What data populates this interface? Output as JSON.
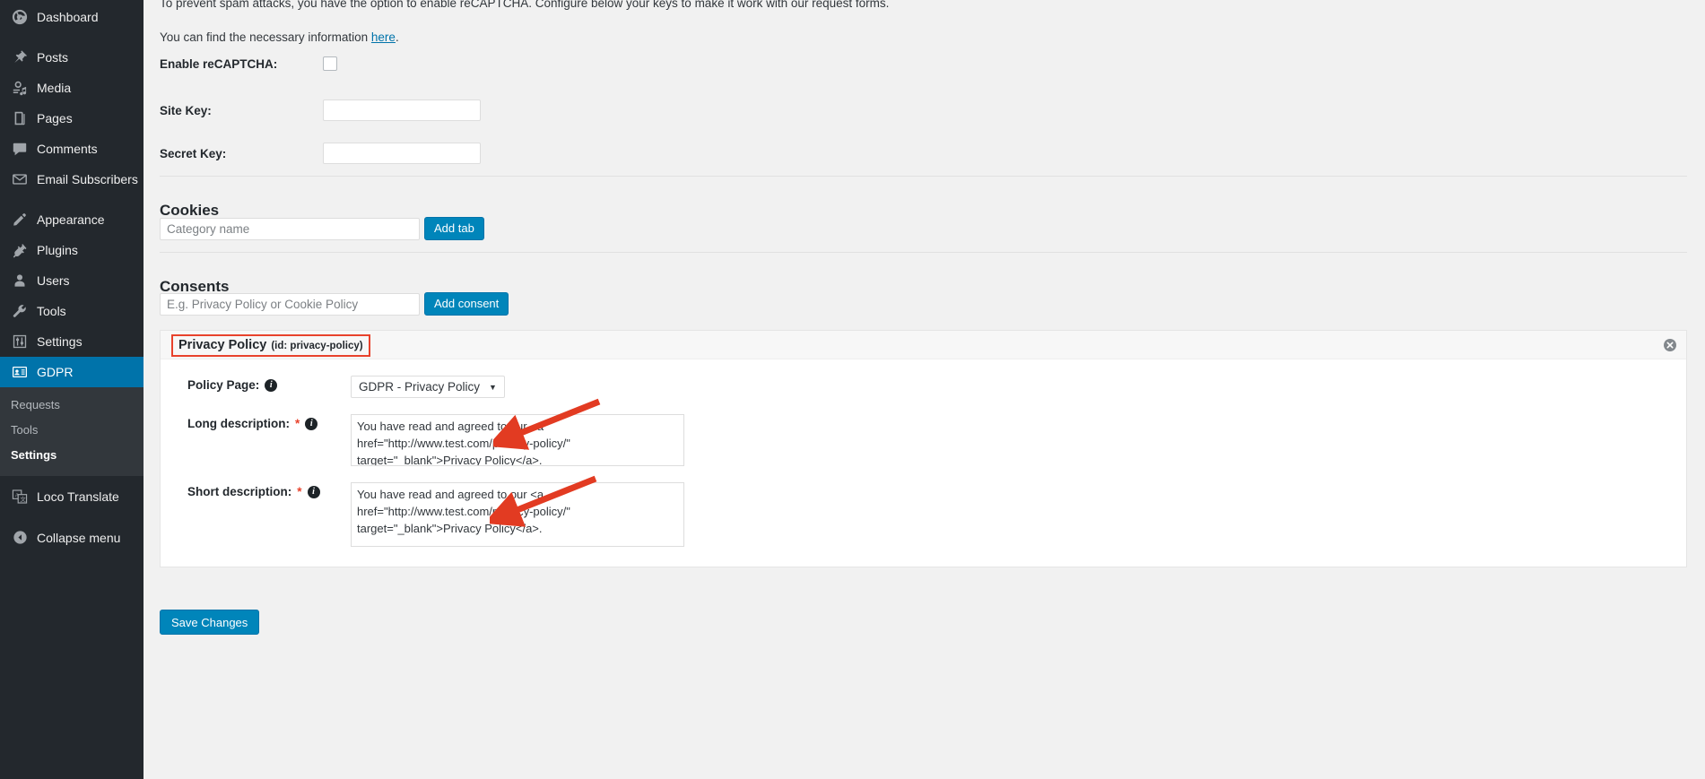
{
  "sidebar": {
    "items": [
      {
        "label": "Dashboard",
        "icon": "dashboard-icon"
      },
      {
        "label": "Posts",
        "icon": "pin-icon"
      },
      {
        "label": "Media",
        "icon": "media-icon"
      },
      {
        "label": "Pages",
        "icon": "pages-icon"
      },
      {
        "label": "Comments",
        "icon": "comments-icon"
      },
      {
        "label": "Email Subscribers",
        "icon": "envelope-icon"
      },
      {
        "label": "Appearance",
        "icon": "brush-icon"
      },
      {
        "label": "Plugins",
        "icon": "plug-icon"
      },
      {
        "label": "Users",
        "icon": "user-icon"
      },
      {
        "label": "Tools",
        "icon": "wrench-icon"
      },
      {
        "label": "Settings",
        "icon": "sliders-icon"
      },
      {
        "label": "GDPR",
        "icon": "id-card-icon"
      }
    ],
    "submenu": [
      {
        "label": "Requests"
      },
      {
        "label": "Tools"
      },
      {
        "label": "Settings"
      }
    ],
    "loco": {
      "label": "Loco Translate",
      "icon": "translate-icon"
    },
    "collapse": {
      "label": "Collapse menu",
      "icon": "collapse-arrow-icon"
    },
    "current_item": "GDPR",
    "current_subitem": "Settings",
    "colors": {
      "background": "#23282d",
      "submenu_background": "#32373c",
      "highlight": "#0073aa"
    }
  },
  "content": {
    "intro_text": "To prevent spam attacks, you have the option to enable reCAPTCHA. Configure below your keys to make it work with our request forms.",
    "info_prefix": "You can find the necessary information ",
    "info_link": "here",
    "info_suffix": ".",
    "enable_recaptcha_label": "Enable reCAPTCHA:",
    "enable_recaptcha_checked": false,
    "site_key_label": "Site Key:",
    "site_key_value": "",
    "secret_key_label": "Secret Key:",
    "secret_key_value": "",
    "cookies": {
      "heading": "Cookies",
      "input_placeholder": "Category name",
      "input_value": "",
      "button_label": "Add tab"
    },
    "consents": {
      "heading": "Consents",
      "input_placeholder": "E.g. Privacy Policy or Cookie Policy",
      "input_value": "",
      "button_label": "Add consent"
    },
    "consent_panel": {
      "title": "Privacy Policy",
      "id_text": "(id: privacy-policy)",
      "close_icon": "close-circle-icon",
      "policy_page_label": "Policy Page:",
      "policy_page_selected": "GDPR - Privacy Policy",
      "long_description_label": "Long description:",
      "long_description_required": "*",
      "long_description_value": "You have read and agreed to our <a href=\"http://www.test.com/privacy-policy/\" target=\"_blank\">Privacy Policy</a>.",
      "short_description_label": "Short description:",
      "short_description_required": "*",
      "short_description_value": "You have read and agreed to our <a href=\"http://www.test.com/privacy-policy/\" target=\"_blank\">Privacy Policy</a>."
    },
    "save_button_label": "Save Changes"
  },
  "annotations": {
    "highlight_color": "#e8422c",
    "arrow_color": "#e23b22",
    "arrow_count": 2
  }
}
